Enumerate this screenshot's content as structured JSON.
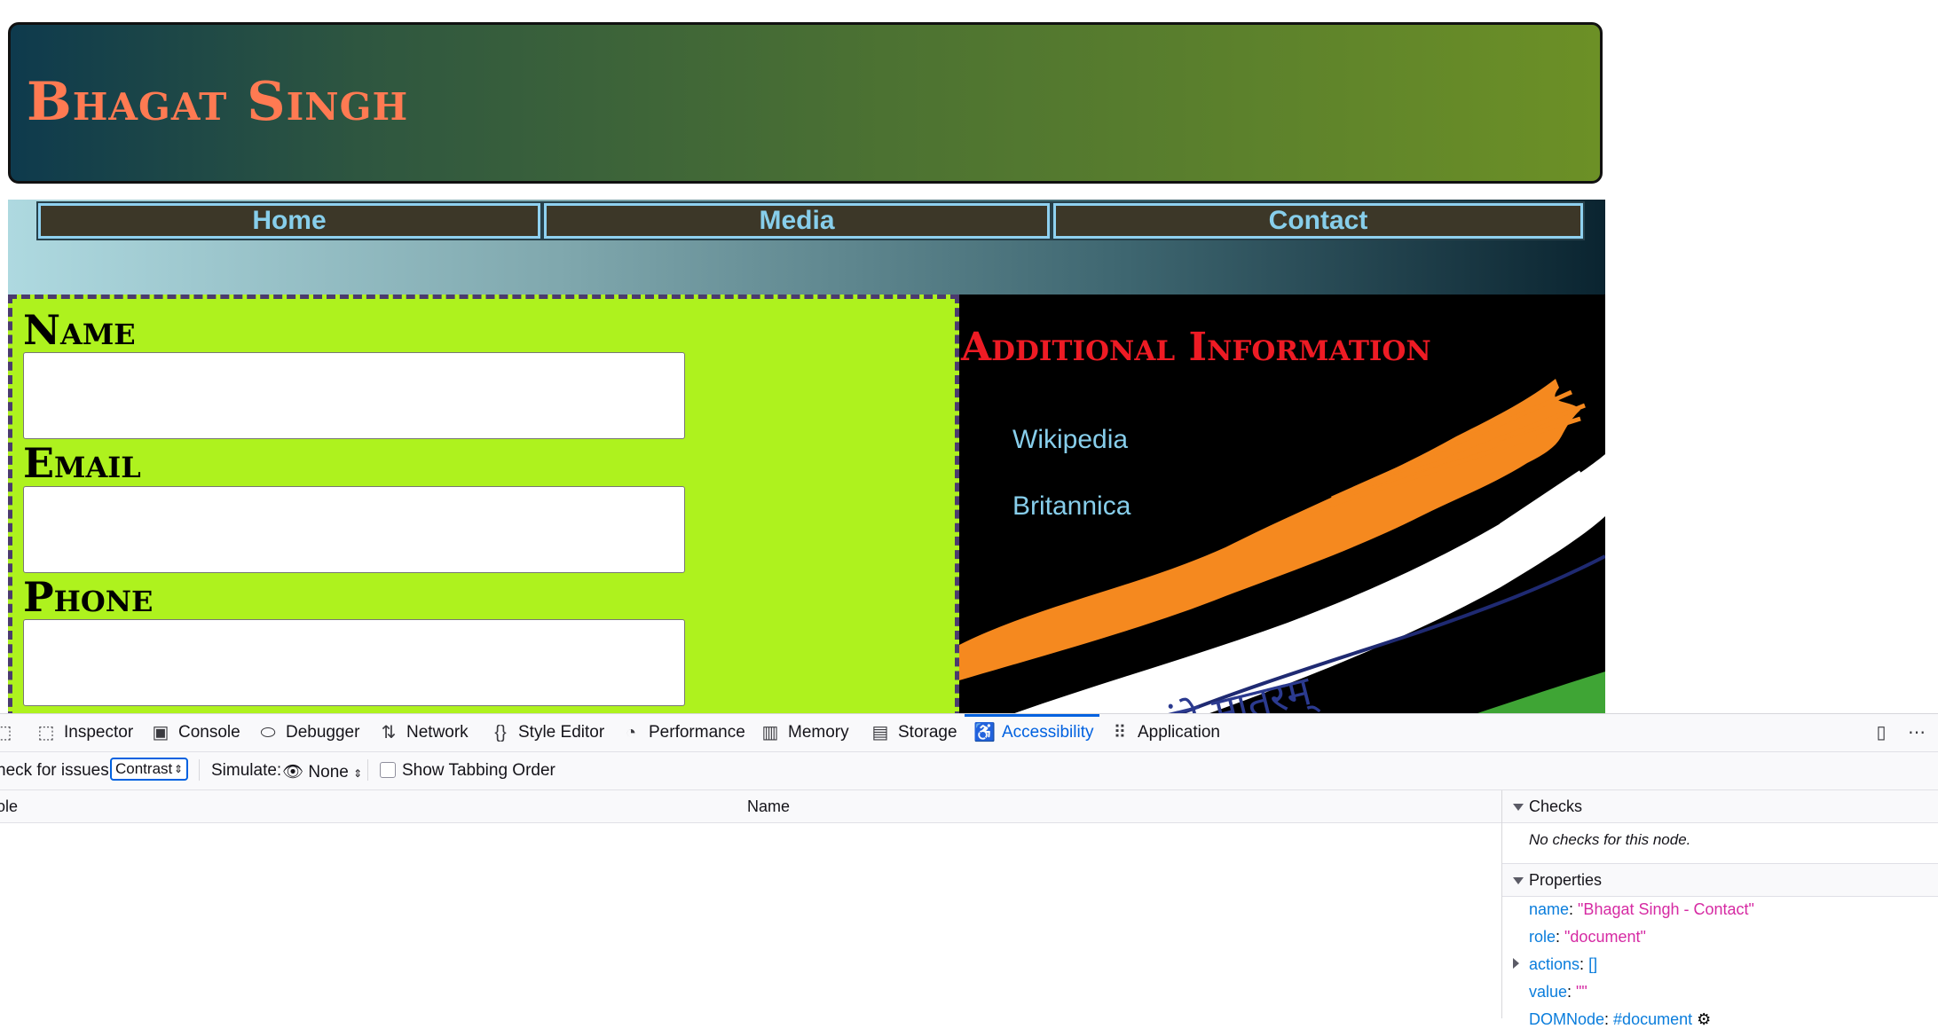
{
  "site": {
    "title": "Bhagat Singh",
    "nav": [
      "Home",
      "Media",
      "Contact"
    ],
    "form": {
      "fields": [
        {
          "label": "Name",
          "value": ""
        },
        {
          "label": "Email",
          "value": ""
        },
        {
          "label": "Phone",
          "value": ""
        }
      ]
    },
    "info": {
      "heading": "Additional Information",
      "links": [
        "Wikipedia",
        "Britannica"
      ],
      "flag_text": "वंदे मातरम्"
    },
    "colors": {
      "title": "#ff7a52",
      "nav_text": "#87ceeb",
      "form_bg": "#aef21e",
      "info_heading": "#ee1b24",
      "saffron": "#f5891f",
      "green": "#3fa535"
    }
  },
  "devtools": {
    "tabs": [
      {
        "label": "Inspector",
        "icon": "inspector-icon"
      },
      {
        "label": "Console",
        "icon": "console-icon"
      },
      {
        "label": "Debugger",
        "icon": "debugger-icon"
      },
      {
        "label": "Network",
        "icon": "network-icon"
      },
      {
        "label": "Style Editor",
        "icon": "style-editor-icon"
      },
      {
        "label": "Performance",
        "icon": "performance-icon"
      },
      {
        "label": "Memory",
        "icon": "memory-icon"
      },
      {
        "label": "Storage",
        "icon": "storage-icon"
      },
      {
        "label": "Accessibility",
        "icon": "accessibility-icon"
      },
      {
        "label": "Application",
        "icon": "application-icon"
      }
    ],
    "active_tab": "Accessibility",
    "toolbar": {
      "check_label": "heck for issues:",
      "check_value": "Contrast",
      "simulate_label": "Simulate:",
      "simulate_value": "None",
      "tabbing_label": "Show Tabbing Order"
    },
    "table": {
      "col_role": "ole",
      "col_name": "Name"
    },
    "sidebar": {
      "checks_title": "Checks",
      "checks_text": "No checks for this node.",
      "properties_title": "Properties",
      "props": [
        {
          "key": "name",
          "value": "\"Bhagat Singh - Contact\""
        },
        {
          "key": "role",
          "value": "\"document\""
        },
        {
          "key": "actions",
          "value": "[]"
        },
        {
          "key": "value",
          "value": "\"\""
        },
        {
          "key": "DOMNode",
          "value": "#document"
        }
      ]
    }
  }
}
